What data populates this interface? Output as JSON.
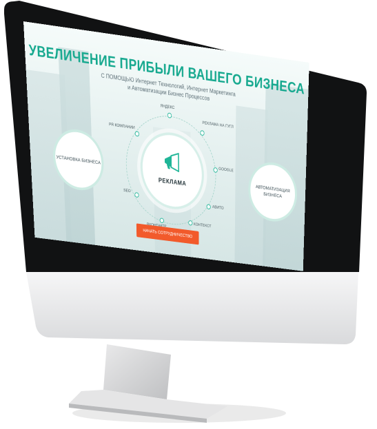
{
  "hero": {
    "title": "УВЕЛИЧЕНИЕ ПРИБЫЛИ ВАШЕГО БИЗНЕСА",
    "subtitle_line1": "С ПОМОЩЬЮ Интернет Технологий, Интернет Маркетинга",
    "subtitle_line2": "и Автоматизации Бизнес Процессов"
  },
  "center": {
    "label": "РЕКЛАМА",
    "icon": "megaphone-icon"
  },
  "left_circle": {
    "label": "УСТАНОВКА БИЗНЕСА"
  },
  "right_circle": {
    "label": "АВТОМАТИЗАЦИЯ БИЗНЕСА"
  },
  "nodes": [
    "ЯНДЕКС",
    "РЕКЛАМА НА ГУГЛ",
    "GOOGLE",
    "АВИТО",
    "КОНТЕКСТ",
    "ВКОНТАКТЕ",
    "SEO",
    "PR КОМПАНИИ"
  ],
  "cta": {
    "label": "НАЧАТЬ СОТРУДНИЧЕСТВО"
  },
  "colors": {
    "accent": "#17a98f",
    "cta": "#f25a2b"
  }
}
